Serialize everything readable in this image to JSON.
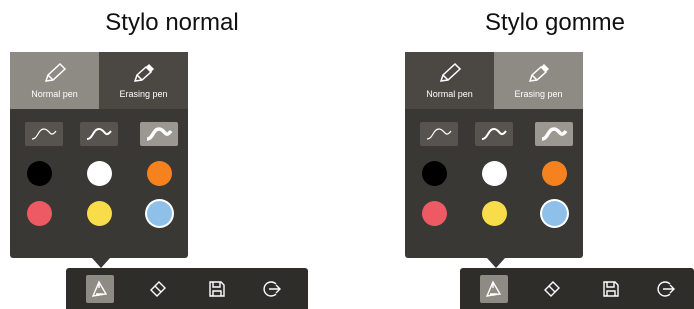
{
  "headings": {
    "left": "Stylo normal",
    "right": "Stylo gomme"
  },
  "pen_panel": {
    "tabs": [
      {
        "label": "Normal pen",
        "icon": "pencil-icon"
      },
      {
        "label": "Erasing pen",
        "icon": "eraser-pencil-icon"
      }
    ],
    "stroke_styles": [
      "thin-stroke",
      "medium-stroke",
      "thick-stroke"
    ],
    "selected_stroke": "thick-stroke",
    "colors": [
      "#000000",
      "#ffffff",
      "#f5821f",
      "#ee5a64",
      "#f9dc4a",
      "#8ec0ea"
    ],
    "selected_color": "#8ec0ea"
  },
  "left_panel": {
    "active_tab": "Normal pen"
  },
  "right_panel": {
    "active_tab": "Erasing pen"
  },
  "toolbar": {
    "items": [
      {
        "name": "pen-icon",
        "active": true
      },
      {
        "name": "eraser-icon",
        "active": false
      },
      {
        "name": "save-icon",
        "active": false
      },
      {
        "name": "exit-icon",
        "active": false
      }
    ]
  },
  "accent": {
    "panel": "#3a3834",
    "selected": "#8e8a84",
    "toolbar": "#2f2d2a"
  }
}
